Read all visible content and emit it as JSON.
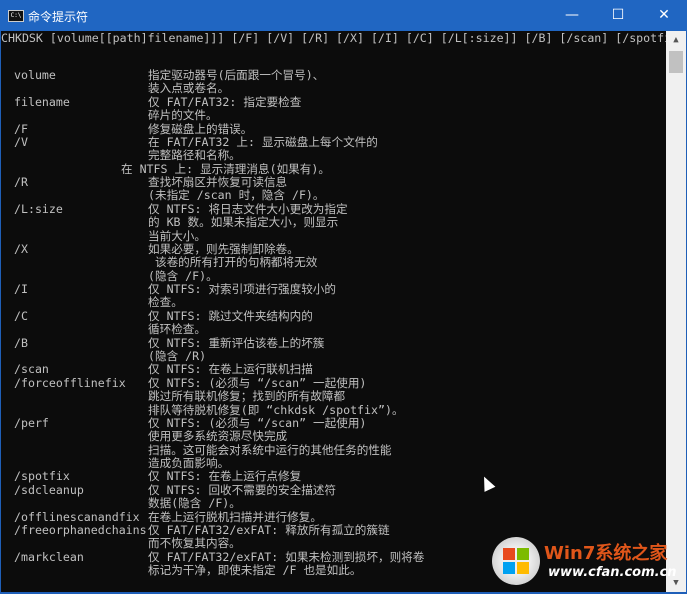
{
  "window": {
    "title": "命令提示符",
    "minimize": "—",
    "maximize": "☐",
    "close": "✕"
  },
  "console": {
    "usage": "CHKDSK [volume[[path]filename]]] [/F] [/V] [/R] [/X] [/I] [/C] [/L[:size]] [/B] [/scan] [/spotfix]",
    "lines": [
      {
        "name": "volume",
        "desc": "指定驱动器号(后面跟一个冒号)、"
      },
      {
        "name": "",
        "desc": "装入点或卷名。"
      },
      {
        "name": "filename",
        "desc": "仅 FAT/FAT32: 指定要检查"
      },
      {
        "name": "",
        "desc": "碎片的文件。"
      },
      {
        "name": "/F",
        "desc": "修复磁盘上的错误。"
      },
      {
        "name": "/V",
        "desc": "在 FAT/FAT32 上: 显示磁盘上每个文件的"
      },
      {
        "name": "",
        "desc": "完整路径和名称。"
      },
      {
        "name": "",
        "desc": "在 NTFS 上: 显示清理消息(如果有)。",
        "indent": "out"
      },
      {
        "name": "/R",
        "desc": "查找坏扇区并恢复可读信息"
      },
      {
        "name": "",
        "desc": "(未指定 /scan 时，隐含 /F)。"
      },
      {
        "name": "/L:size",
        "desc": "仅 NTFS: 将日志文件大小更改为指定"
      },
      {
        "name": "",
        "desc": "的 KB 数。如果未指定大小，则显示"
      },
      {
        "name": "",
        "desc": "当前大小。"
      },
      {
        "name": "/X",
        "desc": "如果必要，则先强制卸除卷。"
      },
      {
        "name": "",
        "desc": " 该卷的所有打开的句柄都将无效"
      },
      {
        "name": "",
        "desc": "(隐含 /F)。"
      },
      {
        "name": "/I",
        "desc": "仅 NTFS: 对索引项进行强度较小的"
      },
      {
        "name": "",
        "desc": "检查。"
      },
      {
        "name": "/C",
        "desc": "仅 NTFS: 跳过文件夹结构内的"
      },
      {
        "name": "",
        "desc": "循环检查。"
      },
      {
        "name": "/B",
        "desc": "仅 NTFS: 重新评估该卷上的坏簇"
      },
      {
        "name": "",
        "desc": "(隐含 /R)"
      },
      {
        "name": "/scan",
        "desc": "仅 NTFS: 在卷上运行联机扫描"
      },
      {
        "name": "/forceofflinefix",
        "desc": "仅 NTFS: (必须与 “/scan” 一起使用)"
      },
      {
        "name": "",
        "desc": "跳过所有联机修复；找到的所有故障都"
      },
      {
        "name": "",
        "desc": "排队等待脱机修复(即 “chkdsk /spotfix”)。"
      },
      {
        "name": "/perf",
        "desc": "仅 NTFS: (必须与 “/scan” 一起使用)"
      },
      {
        "name": "",
        "desc": "使用更多系统资源尽快完成"
      },
      {
        "name": "",
        "desc": "扫描。这可能会对系统中运行的其他任务的性能"
      },
      {
        "name": "",
        "desc": "造成负面影响。"
      },
      {
        "name": "/spotfix",
        "desc": "仅 NTFS: 在卷上运行点修复"
      },
      {
        "name": "/sdcleanup",
        "desc": "仅 NTFS: 回收不需要的安全描述符"
      },
      {
        "name": "",
        "desc": "数据(隐含 /F)。"
      },
      {
        "name": "/offlinescanandfix",
        "desc": "在卷上运行脱机扫描并进行修复。"
      },
      {
        "name": "/freeorphanedchains",
        "desc": "仅 FAT/FAT32/exFAT: 释放所有孤立的簇链"
      },
      {
        "name": "",
        "desc": "而不恢复其内容。"
      },
      {
        "name": "/markclean",
        "desc": "仅 FAT/FAT32/exFAT: 如果未检测到损坏，则将卷"
      },
      {
        "name": "",
        "desc": "标记为干净，即使未指定 /F 也是如此。"
      }
    ]
  },
  "watermark": {
    "brand": "Win7系统之家",
    "url": "www.cfan.com.cn"
  }
}
